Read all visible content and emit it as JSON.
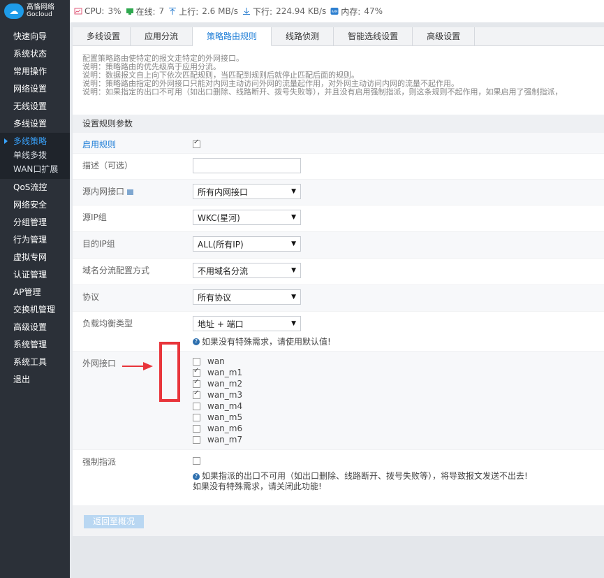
{
  "brand": {
    "logo_cn": "高恪网络",
    "logo_en": "Gocloud",
    "accent": "#1e9be8"
  },
  "topbar": {
    "cpu_label": "CPU:",
    "cpu_value": "3%",
    "online_label": "在线:",
    "online_value": "7",
    "up_label": "上行:",
    "up_value": "2.6 MB/s",
    "down_label": "下行:",
    "down_value": "224.94 KB/s",
    "mem_label": "内存:",
    "mem_value": "47%"
  },
  "sidebar": {
    "items_top": [
      "快速向导",
      "系统状态",
      "常用操作",
      "网络设置",
      "无线设置",
      "多线设置"
    ],
    "sub_items": [
      "多线策略",
      "单线多拨",
      "WAN口扩展"
    ],
    "items_bottom": [
      "QoS流控",
      "网络安全",
      "分组管理",
      "行为管理",
      "虚拟专网",
      "认证管理",
      "AP管理",
      "交换机管理",
      "高级设置",
      "系统管理",
      "系统工具",
      "退出"
    ]
  },
  "tabs": [
    "多线设置",
    "应用分流",
    "策略路由规则",
    "线路侦测",
    "智能选线设置",
    "高级设置"
  ],
  "active_tab": 2,
  "notes": [
    "配置策略路由使特定的报文走特定的外网接口。",
    "说明：策略路由的优先级高于应用分流。",
    "说明：数据报文自上向下依次匹配规则，当匹配到规则后就停止匹配后面的规则。",
    "说明：策略路由指定的外网接口只能对内网主动访问外网的流量起作用，对外网主动访问内网的流量不起作用。",
    "说明：如果指定的出口不可用（如出口删除、线路断开、拨号失败等），并且没有启用强制指派，则这条规则不起作用，如果启用了强制指派，"
  ],
  "form": {
    "section_title": "设置规则参数",
    "enable_label": "启用规则",
    "desc_label": "描述（可选）",
    "desc_value": "",
    "src_if_label": "源内网接口",
    "src_if_value": "所有内网接口",
    "src_ip_label": "源IP组",
    "src_ip_value": "WKC(星河)",
    "dst_ip_label": "目的IP组",
    "dst_ip_value": "ALL(所有IP)",
    "domain_label": "域名分流配置方式",
    "domain_value": "不用域名分流",
    "proto_label": "协议",
    "proto_value": "所有协议",
    "lb_label": "负载均衡类型",
    "lb_value": "地址 + 端口",
    "lb_hint": "如果没有特殊需求，请使用默认值!",
    "wan_label": "外网接口",
    "wan_items": [
      {
        "name": "wan",
        "checked": false
      },
      {
        "name": "wan_m1",
        "checked": true
      },
      {
        "name": "wan_m2",
        "checked": true
      },
      {
        "name": "wan_m3",
        "checked": true
      },
      {
        "name": "wan_m4",
        "checked": false
      },
      {
        "name": "wan_m5",
        "checked": false
      },
      {
        "name": "wan_m6",
        "checked": false
      },
      {
        "name": "wan_m7",
        "checked": false
      }
    ],
    "forced_label": "强制指派",
    "forced_hint1": "如果指派的出口不可用（如出口删除、线路断开、拨号失败等），将导致报文发送不出去!",
    "forced_hint2": "如果没有特殊需求，请关闭此功能!"
  },
  "back_button": "返回至概况",
  "colors": {
    "sidebar": "#2b3038",
    "active_blue": "#1a7bd6",
    "annotation_red": "#e8353b"
  }
}
